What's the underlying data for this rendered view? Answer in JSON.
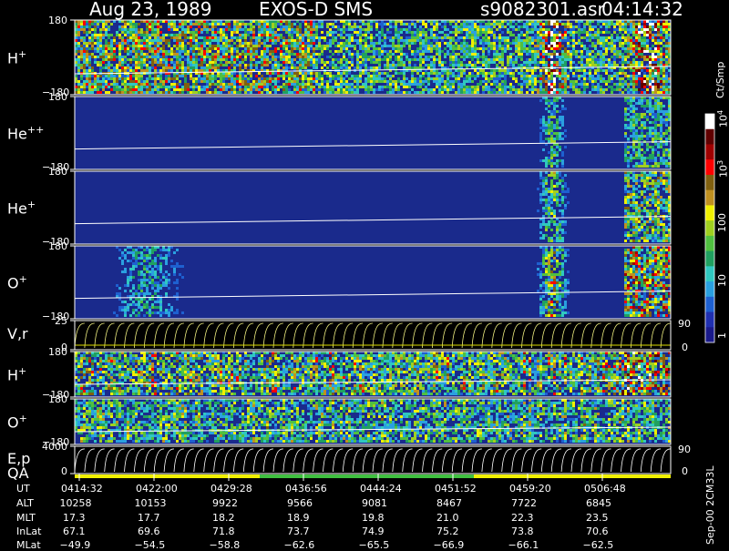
{
  "header": {
    "date": "Aug 23, 1989",
    "instrument": "EXOS-D SMS",
    "file": "s9082301.asr",
    "time": "04:14:32"
  },
  "colorbar": {
    "label": "Ct/Smp",
    "ticks": [
      "1",
      "10",
      "100",
      "10",
      "10"
    ],
    "tick_sups": [
      "",
      "",
      "",
      "3",
      "4"
    ],
    "colors": [
      "#1a1a8a",
      "#2030b0",
      "#1e60d0",
      "#2aa0e0",
      "#30c8c0",
      "#20a060",
      "#50c040",
      "#a0d020",
      "#f0f000",
      "#c09020",
      "#806010",
      "#ff0000",
      "#a00000",
      "#600000",
      "#ffffff"
    ]
  },
  "footer_vertical": "Sep-00  2CM33L",
  "panels": [
    {
      "id": "h-plus-1",
      "label": "H",
      "sup": "+",
      "top_tick": "180",
      "bottom_tick": "−180",
      "right_tick_top": "",
      "right_tick_bottom": "",
      "kind": "spectrogram"
    },
    {
      "id": "he-pp",
      "label": "He",
      "sup": "++",
      "top_tick": "180",
      "bottom_tick": "−180",
      "right_tick_top": "",
      "right_tick_bottom": "",
      "kind": "spectrogram"
    },
    {
      "id": "he-plus",
      "label": "He",
      "sup": "+",
      "top_tick": "180",
      "bottom_tick": "−180",
      "right_tick_top": "",
      "right_tick_bottom": "",
      "kind": "spectrogram"
    },
    {
      "id": "o-plus-1",
      "label": "O",
      "sup": "+",
      "top_tick": "180",
      "bottom_tick": "−180",
      "right_tick_top": "",
      "right_tick_bottom": "",
      "kind": "spectrogram"
    },
    {
      "id": "vr",
      "label": "V,r",
      "sup": "",
      "top_tick": "25",
      "bottom_tick": "0",
      "right_tick_top": "90",
      "right_tick_bottom": "0",
      "kind": "lines"
    },
    {
      "id": "h-plus-2",
      "label": "H",
      "sup": "+",
      "top_tick": "180",
      "bottom_tick": "−180",
      "right_tick_top": "",
      "right_tick_bottom": "",
      "kind": "spectrogram"
    },
    {
      "id": "o-plus-2",
      "label": "O",
      "sup": "+",
      "top_tick": "180",
      "bottom_tick": "−180",
      "right_tick_top": "",
      "right_tick_bottom": "",
      "kind": "spectrogram"
    },
    {
      "id": "ep",
      "label": "E,p",
      "sup": "",
      "top_tick": "4000",
      "bottom_tick": "0",
      "right_tick_top": "90",
      "right_tick_bottom": "0",
      "kind": "lines"
    }
  ],
  "qa_label": "QA",
  "table": {
    "row_labels": [
      "UT",
      "ALT",
      "MLT",
      "InLat",
      "MLat"
    ],
    "columns": [
      [
        "0414:32",
        "10258",
        "17.3",
        "67.1",
        "−49.9"
      ],
      [
        "0422:00",
        "10153",
        "17.7",
        "69.6",
        "−54.5"
      ],
      [
        "0429:28",
        "9922",
        "18.2",
        "71.8",
        "−58.8"
      ],
      [
        "0436:56",
        "9566",
        "18.9",
        "73.7",
        "−62.6"
      ],
      [
        "0444:24",
        "9081",
        "19.8",
        "74.9",
        "−65.5"
      ],
      [
        "0451:52",
        "8467",
        "21.0",
        "75.2",
        "−66.9"
      ],
      [
        "0459:20",
        "7722",
        "22.3",
        "73.8",
        "−66.1"
      ],
      [
        "0506:48",
        "6845",
        "23.5",
        "70.6",
        "−62.5"
      ]
    ]
  },
  "chart_data": {
    "type": "heatmap",
    "title": "Aug 23, 1989   EXOS-D SMS",
    "x_ticks": [
      "0414:32",
      "0422:00",
      "0429:28",
      "0436:56",
      "0444:24",
      "0451:52",
      "0459:20",
      "0506:48"
    ],
    "colorbar_label": "Ct/Smp",
    "colorbar_scale": "log",
    "colorbar_range": [
      1,
      10000
    ],
    "panels": [
      "H+",
      "He++",
      "He+",
      "O+",
      "V,r",
      "H+",
      "O+",
      "E,p"
    ],
    "y_range_spectrogram": [
      -180,
      180
    ],
    "y_range_vr": [
      0,
      25
    ],
    "y_range_ep": [
      0,
      4000
    ]
  }
}
